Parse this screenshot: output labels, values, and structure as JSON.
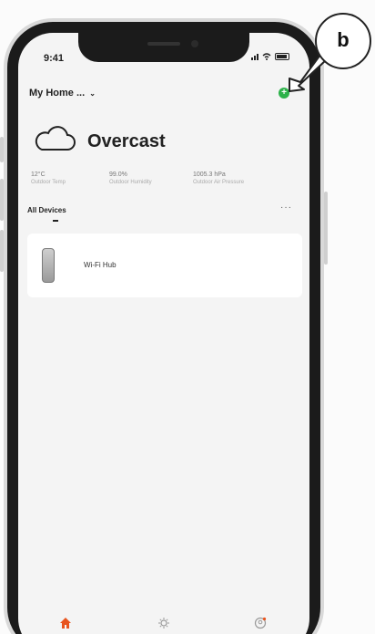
{
  "status_bar": {
    "time": "9:41"
  },
  "header": {
    "home_title": "My Home ...",
    "chevron": "⌄",
    "add_icon": "+"
  },
  "weather": {
    "icon": "cloud-icon",
    "condition": "Overcast",
    "metrics": [
      {
        "value": "12°C",
        "label": "Outdoor Temp"
      },
      {
        "value": "99.0%",
        "label": "Outdoor Humidity"
      },
      {
        "value": "1005.3 hPa",
        "label": "Outdoor Air Pressure"
      }
    ]
  },
  "devices_tab": {
    "label": "All Devices",
    "more": "···"
  },
  "device": {
    "name": "Wi-Fi Hub"
  },
  "bottom_nav": {
    "items": [
      "home-icon",
      "smart-icon",
      "me-icon"
    ],
    "active_color": "#e8541e"
  },
  "annotation": {
    "label": "b"
  },
  "colors": {
    "accent_green": "#2db24a",
    "active_orange": "#e8541e"
  }
}
